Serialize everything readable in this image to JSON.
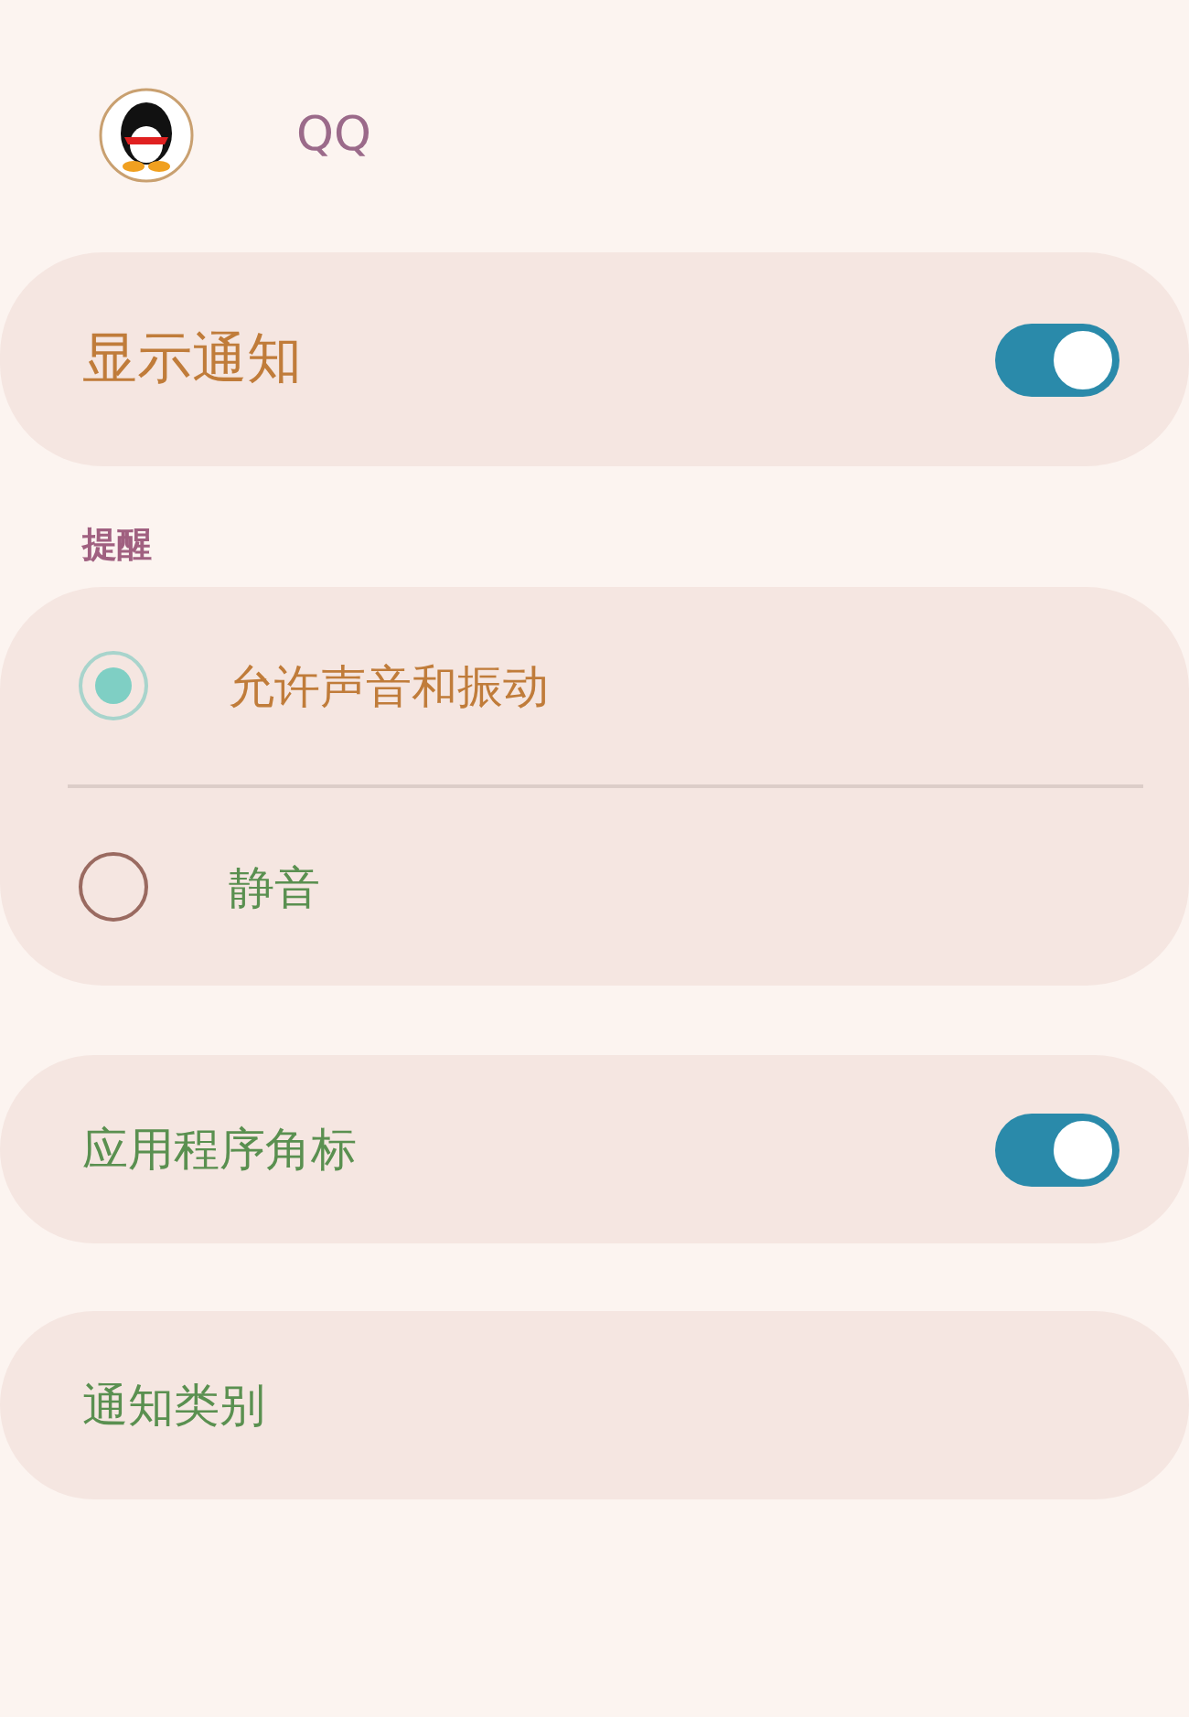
{
  "app": {
    "name": "QQ"
  },
  "show_notifications": {
    "label": "显示通知",
    "on": true
  },
  "alerts": {
    "title": "提醒",
    "options": [
      {
        "label": "允许声音和振动",
        "selected": true
      },
      {
        "label": "静音",
        "selected": false
      }
    ]
  },
  "app_badges": {
    "label": "应用程序角标",
    "on": true
  },
  "categories": {
    "label": "通知类别"
  }
}
